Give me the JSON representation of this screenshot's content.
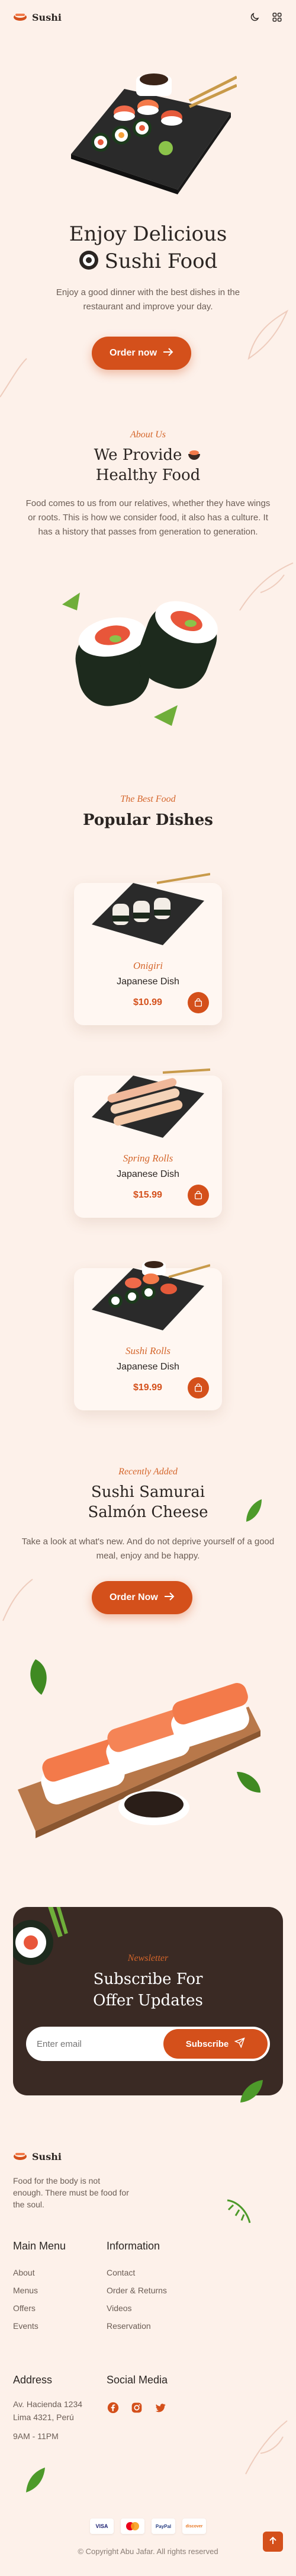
{
  "colors": {
    "accent": "#d4501b",
    "background": "#fdf1ea",
    "dark": "#3a2a24",
    "text": "#2b2522"
  },
  "header": {
    "logo_text": "Sushi",
    "icons": [
      "moon-icon",
      "grid-menu-icon"
    ]
  },
  "hero": {
    "title_line1": "Enjoy Delicious",
    "title_line2": "Sushi Food",
    "description": "Enjoy a good dinner with the best dishes in the restaurant and improve your day.",
    "cta_label": "Order now"
  },
  "about": {
    "kicker": "About Us",
    "title_line1": "We Provide",
    "title_line2": "Healthy Food",
    "description": "Food comes to us from our relatives, whether they have wings or roots. This is how we consider food, it also has a culture. It has a history that passes from generation to generation."
  },
  "popular": {
    "kicker": "The Best Food",
    "title": "Popular Dishes",
    "dishes": [
      {
        "name": "Onigiri",
        "subtitle": "Japanese Dish",
        "price": "$10.99"
      },
      {
        "name": "Spring Rolls",
        "subtitle": "Japanese Dish",
        "price": "$15.99"
      },
      {
        "name": "Sushi Rolls",
        "subtitle": "Japanese Dish",
        "price": "$19.99"
      }
    ]
  },
  "recent": {
    "kicker": "Recently Added",
    "title_line1": "Sushi Samurai",
    "title_line2": "Salmón Cheese",
    "description": "Take a look at what's new. And do not deprive yourself of a good meal, enjoy and be happy.",
    "cta_label": "Order Now"
  },
  "newsletter": {
    "kicker": "Newsletter",
    "title_line1": "Subscribe For",
    "title_line2": "Offer Updates",
    "email_placeholder": "Enter email",
    "button_label": "Subscribe"
  },
  "footer": {
    "logo_text": "Sushi",
    "tagline": "Food for the body is not enough. There must be food for the soul.",
    "main_menu": {
      "title": "Main Menu",
      "links": [
        "About",
        "Menus",
        "Offers",
        "Events"
      ]
    },
    "information": {
      "title": "Information",
      "links": [
        "Contact",
        "Order & Returns",
        "Videos",
        "Reservation"
      ]
    },
    "address": {
      "title": "Address",
      "line1": "Av. Hacienda 1234",
      "line2": "Lima 4321, Perú",
      "hours": "9AM - 11PM"
    },
    "social": {
      "title": "Social Media",
      "icons": [
        "facebook-icon",
        "instagram-icon",
        "twitter-icon"
      ]
    },
    "payments": [
      "VISA",
      "mastercard",
      "PayPal",
      "discover"
    ],
    "copyright": "© Copyright Abu Jafar. All rights reserved"
  }
}
